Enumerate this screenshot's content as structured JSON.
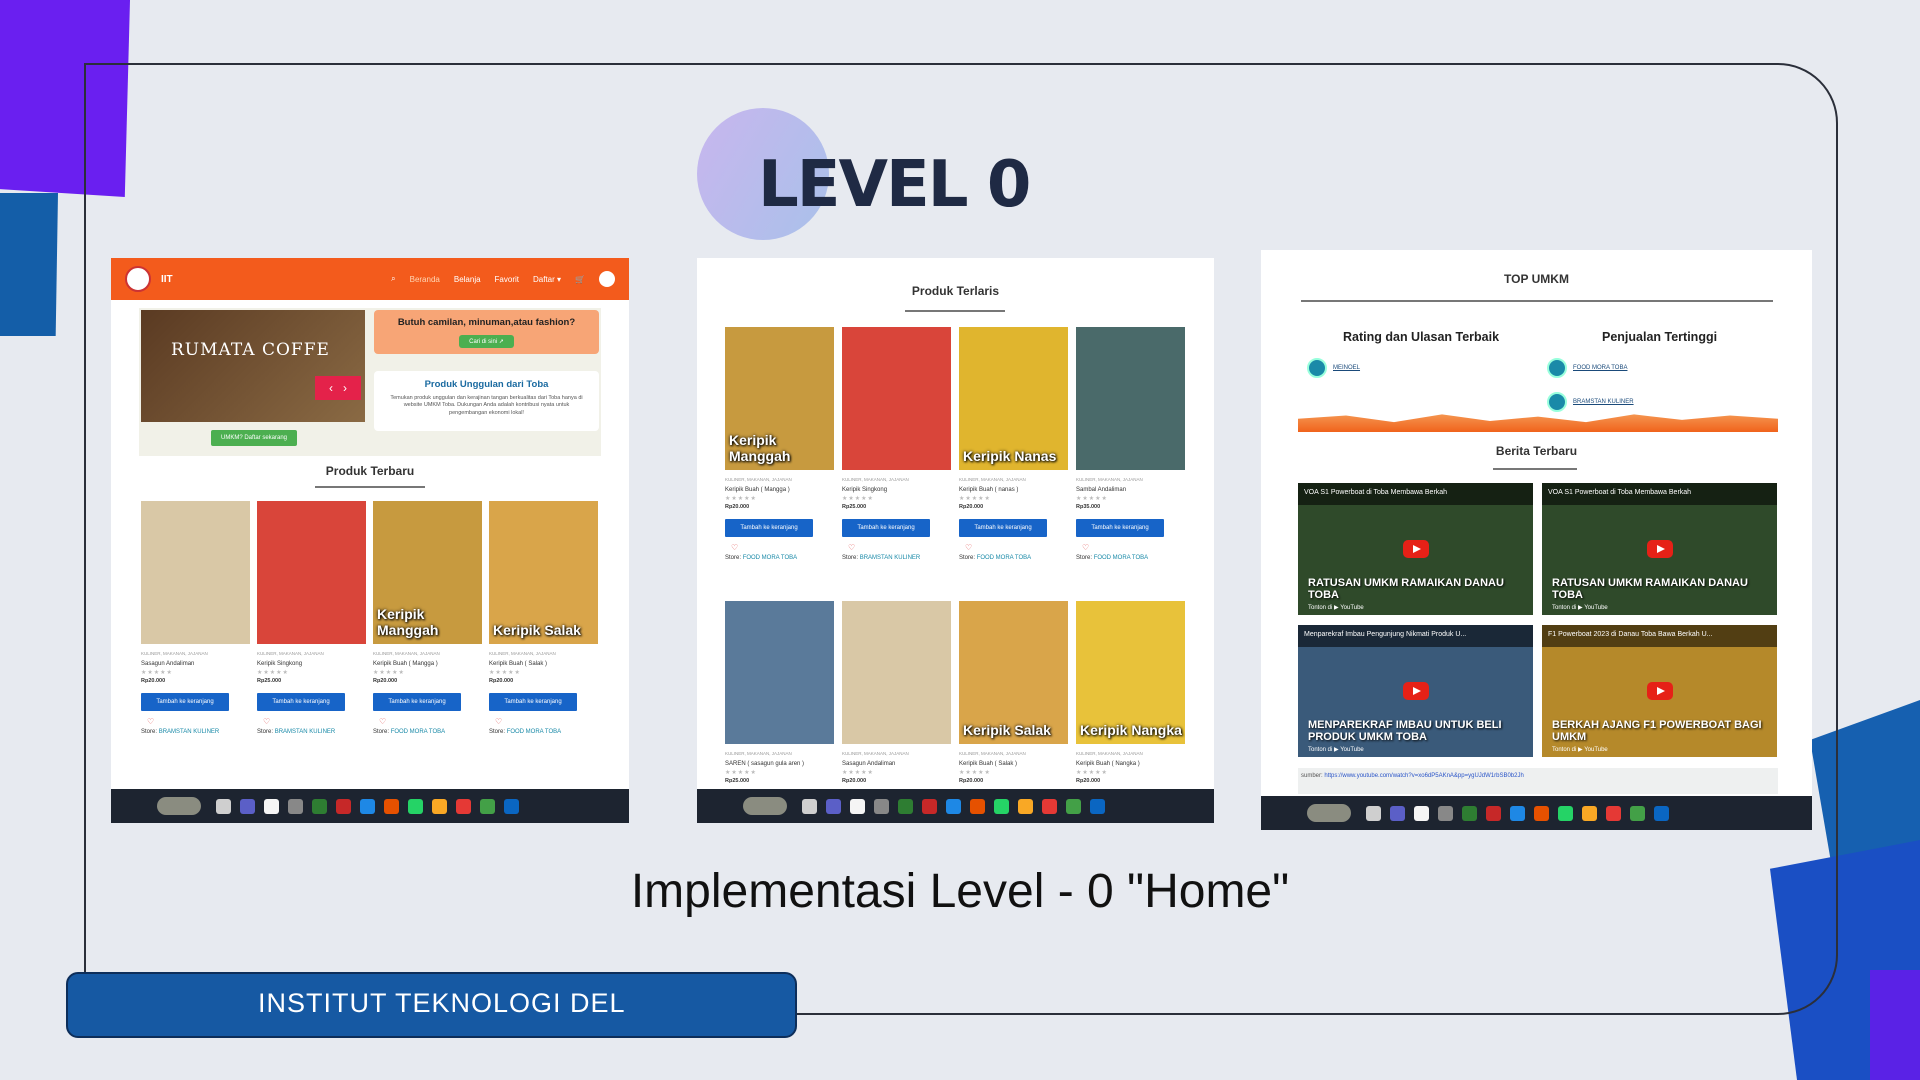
{
  "slide": {
    "title": "LEVEL 0",
    "caption": "Implementasi Level - 0 \"Home\"",
    "footer": "INSTITUT TEKNOLOGI DEL"
  },
  "shot1": {
    "brand": "IIT",
    "nav": [
      "Beranda",
      "Belanja",
      "Favorit",
      "Daftar ▾"
    ],
    "hero_name": "RUMATA COFFE",
    "daftar_button": "UMKM? Daftar sekarang",
    "ask_title": "Butuh camilan, minuman,atau fashion?",
    "ask_button": "Cari di sini ➚",
    "featured_title": "Produk Unggulan dari Toba",
    "featured_text": "Temukan produk unggulan dan kerajinan tangan berkualitas dari Toba hanya di website UMKM Toba. Dukungan Anda adalah kontribusi nyata untuk pengembangan ekonomi lokal!",
    "section_title": "Produk Terbaru",
    "products": [
      {
        "name": "Sasagun Andaliman",
        "price": "Rp20.000",
        "store": "BRAMSTAN KULINER",
        "img_label": "",
        "color": "#d9c8a6"
      },
      {
        "name": "Keripik Singkong",
        "price": "Rp25.000",
        "store": "BRAMSTAN KULINER",
        "img_label": "",
        "color": "#d9453a"
      },
      {
        "name": "Keripik Buah ( Mangga )",
        "price": "Rp20.000",
        "store": "FOOD MORA TOBA",
        "img_label": "Keripik Manggah",
        "color": "#c79a3f"
      },
      {
        "name": "Keripik Buah ( Salak )",
        "price": "Rp20.000",
        "store": "FOOD MORA TOBA",
        "img_label": "Keripik Salak",
        "color": "#d9a54a"
      }
    ],
    "category": "KULINER, MAKANAN, JAJANAN",
    "cart_button": "Tambah ke keranjang",
    "store_prefix": "Store:"
  },
  "shot2": {
    "section_title": "Produk Terlaris",
    "row1": [
      {
        "name": "Keripik Buah ( Mangga )",
        "price": "Rp20.000",
        "store": "FOOD MORA TOBA",
        "img_label": "Keripik Manggah",
        "color": "#c79a3f"
      },
      {
        "name": "Keripik Singkong",
        "price": "Rp25.000",
        "store": "BRAMSTAN KULINER",
        "img_label": "",
        "color": "#d9453a"
      },
      {
        "name": "Keripik Buah ( nanas )",
        "price": "Rp20.000",
        "store": "FOOD MORA TOBA",
        "img_label": "Keripik Nanas",
        "color": "#e0b52e"
      },
      {
        "name": "Sambal Andaliman",
        "price": "Rp35.000",
        "store": "FOOD MORA TOBA",
        "img_label": "",
        "color": "#4a6a6a"
      }
    ],
    "row2": [
      {
        "name": "SAREN ( sasagun gula aren )",
        "price": "Rp25.000",
        "img_label": "",
        "color": "#5a7a9a"
      },
      {
        "name": "Sasagun Andaliman",
        "price": "Rp20.000",
        "img_label": "",
        "color": "#d9c8a6"
      },
      {
        "name": "Keripik Buah ( Salak )",
        "price": "Rp20.000",
        "img_label": "Keripik Salak",
        "color": "#d9a54a"
      },
      {
        "name": "Keripik Buah ( Nangka )",
        "price": "Rp20.000",
        "img_label": "Keripik Nangka",
        "color": "#e8c23a"
      }
    ],
    "category": "KULINER, MAKANAN, JAJANAN",
    "cart_button": "Tambah ke keranjang",
    "store_prefix": "Store:"
  },
  "shot3": {
    "top_title": "TOP UMKM",
    "rating_title": "Rating dan Ulasan Terbaik",
    "sales_title": "Penjualan Tertinggi",
    "rating_item": "MEINOEL",
    "sales_items": [
      "FOOD MORA TOBA",
      "BRAMSTAN KULINER"
    ],
    "news_title": "Berita Terbaru",
    "videos": [
      {
        "top": "VOA S1 Powerboat di Toba Membawa Berkah",
        "caption": "RATUSAN UMKM RAMAIKAN DANAU TOBA",
        "color": "#2f4a2a"
      },
      {
        "top": "VOA S1 Powerboat di Toba Membawa Berkah",
        "caption": "RATUSAN UMKM RAMAIKAN DANAU TOBA",
        "color": "#2f4a2a"
      },
      {
        "top": "Menparekraf Imbau Pengunjung Nikmati Produk U...",
        "caption": "MENPAREKRAF IMBAU UNTUK BELI PRODUK UMKM TOBA",
        "color": "#3a5a7a"
      },
      {
        "top": "F1 Powerboat 2023 di Danau Toba Bawa Berkah U...",
        "caption": "BERKAH AJANG F1 POWERBOAT BAGI UMKM",
        "color": "#b5892a"
      }
    ],
    "watch_label": "Tonton di ▶ YouTube",
    "source_prefix": "sumber:",
    "source_link": "https://www.youtube.com/watch?v=xo6dP5AKnA&pp=ygUJdW1rbSB0b2Jh"
  },
  "taskbar_colors": [
    "#cfcfcf",
    "#5b5fc7",
    "#f5f5f5",
    "#888",
    "#2e7d32",
    "#c62828",
    "#1e88e5",
    "#e65100",
    "#25d366",
    "#f9a825",
    "#e53935",
    "#43a047",
    "#0a66c2"
  ]
}
